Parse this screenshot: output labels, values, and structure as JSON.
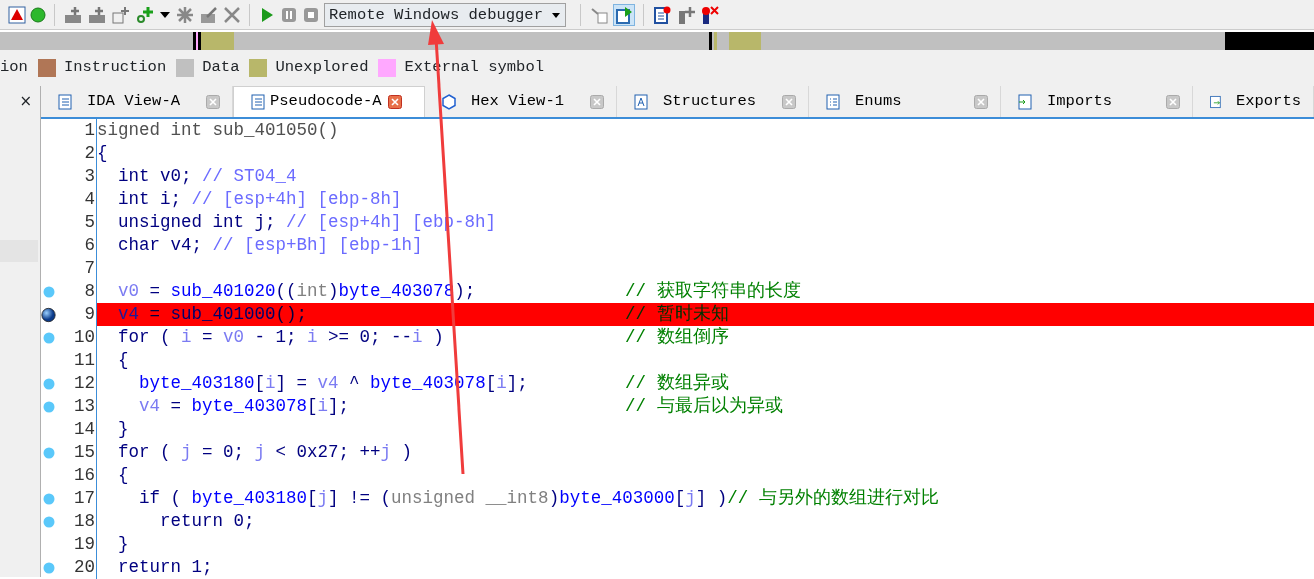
{
  "toolbar": {
    "debugger": {
      "value": "Remote Windows debugger"
    }
  },
  "legend": [
    {
      "label": "ion"
    },
    {
      "label": "Instruction",
      "color": "#b07656"
    },
    {
      "label": "Data",
      "color": "#c0c0c0"
    },
    {
      "label": "Unexplored",
      "color": "#b8b76a"
    },
    {
      "label": "External symbol",
      "color": "#ffa8ff"
    }
  ],
  "left_panel": {
    "close": "×"
  },
  "tabs": [
    {
      "label": "IDA View-A",
      "selected": false,
      "closable": true,
      "kind": "disasm"
    },
    {
      "label": "Pseudocode-A",
      "selected": true,
      "closable": true,
      "kind": "pseudo"
    },
    {
      "label": "Hex View-1",
      "selected": false,
      "closable": true,
      "kind": "hex"
    },
    {
      "label": "Structures",
      "selected": false,
      "closable": true,
      "kind": "struct"
    },
    {
      "label": "Enums",
      "selected": false,
      "closable": true,
      "kind": "enum"
    },
    {
      "label": "Imports",
      "selected": false,
      "closable": true,
      "kind": "import"
    },
    {
      "label": "Exports",
      "selected": false,
      "closable": false,
      "kind": "export"
    }
  ],
  "lines": [
    {
      "number": "1",
      "breakpoint": false,
      "current": false,
      "highlighted": false,
      "tokens": [
        {
          "text": "signed int sub_401050()",
          "kind": "header"
        }
      ]
    },
    {
      "number": "2",
      "breakpoint": false,
      "current": false,
      "highlighted": false,
      "tokens": [
        {
          "text": "{",
          "kind": "code"
        }
      ]
    },
    {
      "number": "3",
      "breakpoint": false,
      "current": false,
      "highlighted": false,
      "tokens": [
        {
          "text": "  int v0; ",
          "kind": "code"
        },
        {
          "text": "// ST04_4",
          "kind": "note"
        }
      ]
    },
    {
      "number": "4",
      "breakpoint": false,
      "current": false,
      "highlighted": false,
      "tokens": [
        {
          "text": "  int i; ",
          "kind": "code"
        },
        {
          "text": "// [esp+4h] [ebp-8h]",
          "kind": "note"
        }
      ]
    },
    {
      "number": "5",
      "breakpoint": false,
      "current": false,
      "highlighted": false,
      "tokens": [
        {
          "text": "  unsigned int j; ",
          "kind": "code"
        },
        {
          "text": "// [esp+4h] [ebp-8h]",
          "kind": "note"
        }
      ]
    },
    {
      "number": "6",
      "breakpoint": false,
      "current": false,
      "highlighted": false,
      "tokens": [
        {
          "text": "  char v4; ",
          "kind": "code"
        },
        {
          "text": "// [esp+Bh] [ebp-1h]",
          "kind": "note"
        }
      ]
    },
    {
      "number": "7",
      "breakpoint": false,
      "current": false,
      "highlighted": false
    },
    {
      "number": "8",
      "breakpoint": true,
      "current": false,
      "highlighted": false,
      "tokens": [
        {
          "text": "  v0",
          "kind": "var"
        },
        {
          "text": " = ",
          "kind": "code"
        },
        {
          "text": "sub_401020",
          "kind": "name"
        },
        {
          "text": "((",
          "kind": "code"
        },
        {
          "text": "int",
          "kind": "type"
        },
        {
          "text": ")",
          "kind": "code"
        },
        {
          "text": "byte_403078",
          "kind": "name"
        },
        {
          "text": ");",
          "kind": "code"
        }
      ],
      "comment": "// 获取字符串的长度"
    },
    {
      "number": "9",
      "breakpoint": true,
      "current": true,
      "highlighted": true,
      "tokens": [
        {
          "text": "  v4",
          "kind": "var"
        },
        {
          "text": " = ",
          "kind": "code"
        },
        {
          "text": "sub_401000",
          "kind": "name"
        },
        {
          "text": "();",
          "kind": "code"
        }
      ],
      "comment": "// 暂时未知"
    },
    {
      "number": "10",
      "breakpoint": true,
      "current": false,
      "highlighted": false,
      "tokens": [
        {
          "text": "  for ( ",
          "kind": "code"
        },
        {
          "text": "i",
          "kind": "var"
        },
        {
          "text": " = ",
          "kind": "code"
        },
        {
          "text": "v0",
          "kind": "var"
        },
        {
          "text": " - 1; ",
          "kind": "code"
        },
        {
          "text": "i",
          "kind": "var"
        },
        {
          "text": " >= 0; --",
          "kind": "code"
        },
        {
          "text": "i",
          "kind": "var"
        },
        {
          "text": " )",
          "kind": "code"
        }
      ],
      "comment": "// 数组倒序"
    },
    {
      "number": "11",
      "breakpoint": false,
      "current": false,
      "highlighted": false,
      "tokens": [
        {
          "text": "  {",
          "kind": "code"
        }
      ]
    },
    {
      "number": "12",
      "breakpoint": true,
      "current": false,
      "highlighted": false,
      "tokens": [
        {
          "text": "    byte_403180",
          "kind": "name"
        },
        {
          "text": "[",
          "kind": "code"
        },
        {
          "text": "i",
          "kind": "var"
        },
        {
          "text": "] = ",
          "kind": "code"
        },
        {
          "text": "v4",
          "kind": "var"
        },
        {
          "text": " ^ ",
          "kind": "code"
        },
        {
          "text": "byte_403078",
          "kind": "name"
        },
        {
          "text": "[",
          "kind": "code"
        },
        {
          "text": "i",
          "kind": "var"
        },
        {
          "text": "];",
          "kind": "code"
        }
      ],
      "comment": "// 数组异或"
    },
    {
      "number": "13",
      "breakpoint": true,
      "current": false,
      "highlighted": false,
      "tokens": [
        {
          "text": "    v4",
          "kind": "var"
        },
        {
          "text": " = ",
          "kind": "code"
        },
        {
          "text": "byte_403078",
          "kind": "name"
        },
        {
          "text": "[",
          "kind": "code"
        },
        {
          "text": "i",
          "kind": "var"
        },
        {
          "text": "];",
          "kind": "code"
        }
      ],
      "comment": "// 与最后以为异或"
    },
    {
      "number": "14",
      "breakpoint": false,
      "current": false,
      "highlighted": false,
      "tokens": [
        {
          "text": "  }",
          "kind": "code"
        }
      ]
    },
    {
      "number": "15",
      "breakpoint": true,
      "current": false,
      "highlighted": false,
      "tokens": [
        {
          "text": "  for ( ",
          "kind": "code"
        },
        {
          "text": "j",
          "kind": "var"
        },
        {
          "text": " = 0; ",
          "kind": "code"
        },
        {
          "text": "j",
          "kind": "var"
        },
        {
          "text": " < 0x27; ++",
          "kind": "code"
        },
        {
          "text": "j",
          "kind": "var"
        },
        {
          "text": " )",
          "kind": "code"
        }
      ]
    },
    {
      "number": "16",
      "breakpoint": false,
      "current": false,
      "highlighted": false,
      "tokens": [
        {
          "text": "  {",
          "kind": "code"
        }
      ]
    },
    {
      "number": "17",
      "breakpoint": true,
      "current": false,
      "highlighted": false,
      "tokens": [
        {
          "text": "    if ( ",
          "kind": "code"
        },
        {
          "text": "byte_403180",
          "kind": "name"
        },
        {
          "text": "[",
          "kind": "code"
        },
        {
          "text": "j",
          "kind": "var"
        },
        {
          "text": "] != (",
          "kind": "code"
        },
        {
          "text": "unsigned __int8",
          "kind": "type"
        },
        {
          "text": ")",
          "kind": "code"
        },
        {
          "text": "byte_403000",
          "kind": "name"
        },
        {
          "text": "[",
          "kind": "code"
        },
        {
          "text": "j",
          "kind": "var"
        },
        {
          "text": "] )",
          "kind": "code"
        },
        {
          "text": "// 与另外的数组进行对比",
          "kind": "comment"
        }
      ]
    },
    {
      "number": "18",
      "breakpoint": true,
      "current": false,
      "highlighted": false,
      "tokens": [
        {
          "text": "      return 0;",
          "kind": "code"
        }
      ]
    },
    {
      "number": "19",
      "breakpoint": false,
      "current": false,
      "highlighted": false,
      "tokens": [
        {
          "text": "  }",
          "kind": "code"
        }
      ]
    },
    {
      "number": "20",
      "breakpoint": true,
      "current": false,
      "highlighted": false,
      "tokens": [
        {
          "text": "  return 1;",
          "kind": "code"
        }
      ]
    }
  ]
}
